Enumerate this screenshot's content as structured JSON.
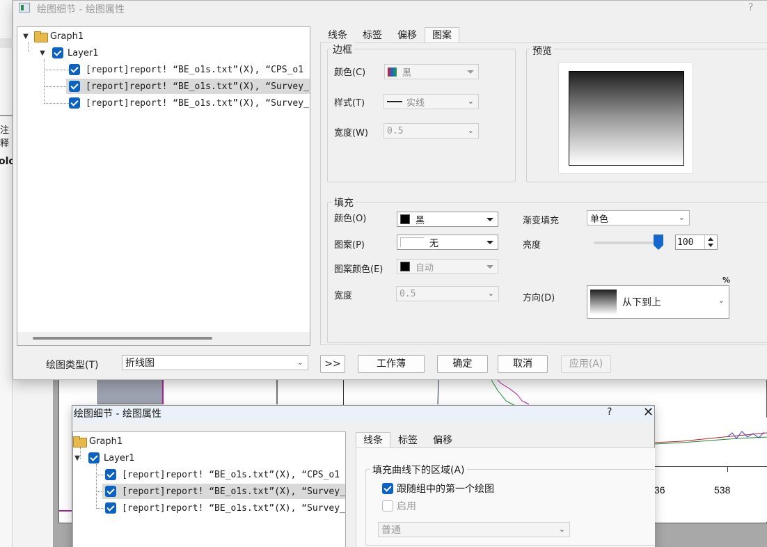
{
  "bg": {
    "left_text_1": "注释",
    "left_text_2": "olo",
    "tick_1": "36",
    "tick_2": "538"
  },
  "main_dialog": {
    "title": "绘图细节 - 绘图属性",
    "help": "?",
    "tree": {
      "root": "Graph1",
      "layer": "Layer1",
      "items": [
        "[report]report! “BE_o1s.txt”(X), “CPS_o1",
        "[report]report! “BE_o1s.txt”(X), “Survey_",
        "[report]report! “BE_o1s.txt”(X), “Survey_"
      ]
    },
    "tabs": [
      "线条",
      "标签",
      "偏移",
      "图案"
    ],
    "border_group": {
      "title": "边框",
      "color_label": "颜色(C)",
      "color_value": "黑",
      "style_label": "样式(T)",
      "style_value": "实线",
      "width_label": "宽度(W)",
      "width_value": "0.5"
    },
    "preview_group": {
      "title": "预览"
    },
    "fill_group": {
      "title": "填充",
      "color_label": "颜色(O)",
      "color_value": "黑",
      "pattern_label": "图案(P)",
      "pattern_value": "无",
      "pattern_color_label": "图案颜色(E)",
      "pattern_color_value": "自动",
      "width_label": "宽度",
      "width_value": "0.5",
      "gradient_label": "渐变填充",
      "gradient_value": "单色",
      "brightness_label": "亮度",
      "brightness_value": "100",
      "percent": "%",
      "direction_label": "方向(D)",
      "direction_value": "从下到上"
    },
    "bottom": {
      "plot_type_label": "绘图类型(T)",
      "plot_type_value": "折线图",
      "expand": ">>",
      "workbook": "工作薄",
      "ok": "确定",
      "cancel": "取消",
      "apply": "应用(A)"
    }
  },
  "second_dialog": {
    "title": "绘图细节 - 绘图属性",
    "help": "?",
    "close": "✕",
    "tree": {
      "root": "Graph1",
      "layer": "Layer1",
      "items": [
        "[report]report! “BE_o1s.txt”(X), “CPS_o1",
        "[report]report! “BE_o1s.txt”(X), “Survey_",
        "[report]report! “BE_o1s.txt”(X), “Survey_"
      ]
    },
    "tabs": [
      "线条",
      "标签",
      "偏移"
    ],
    "fill_area_group": "填充曲线下的区域(A)",
    "follow_first": "跟随组中的第一个绘图",
    "enable": "启用",
    "mode_value": "普通"
  }
}
